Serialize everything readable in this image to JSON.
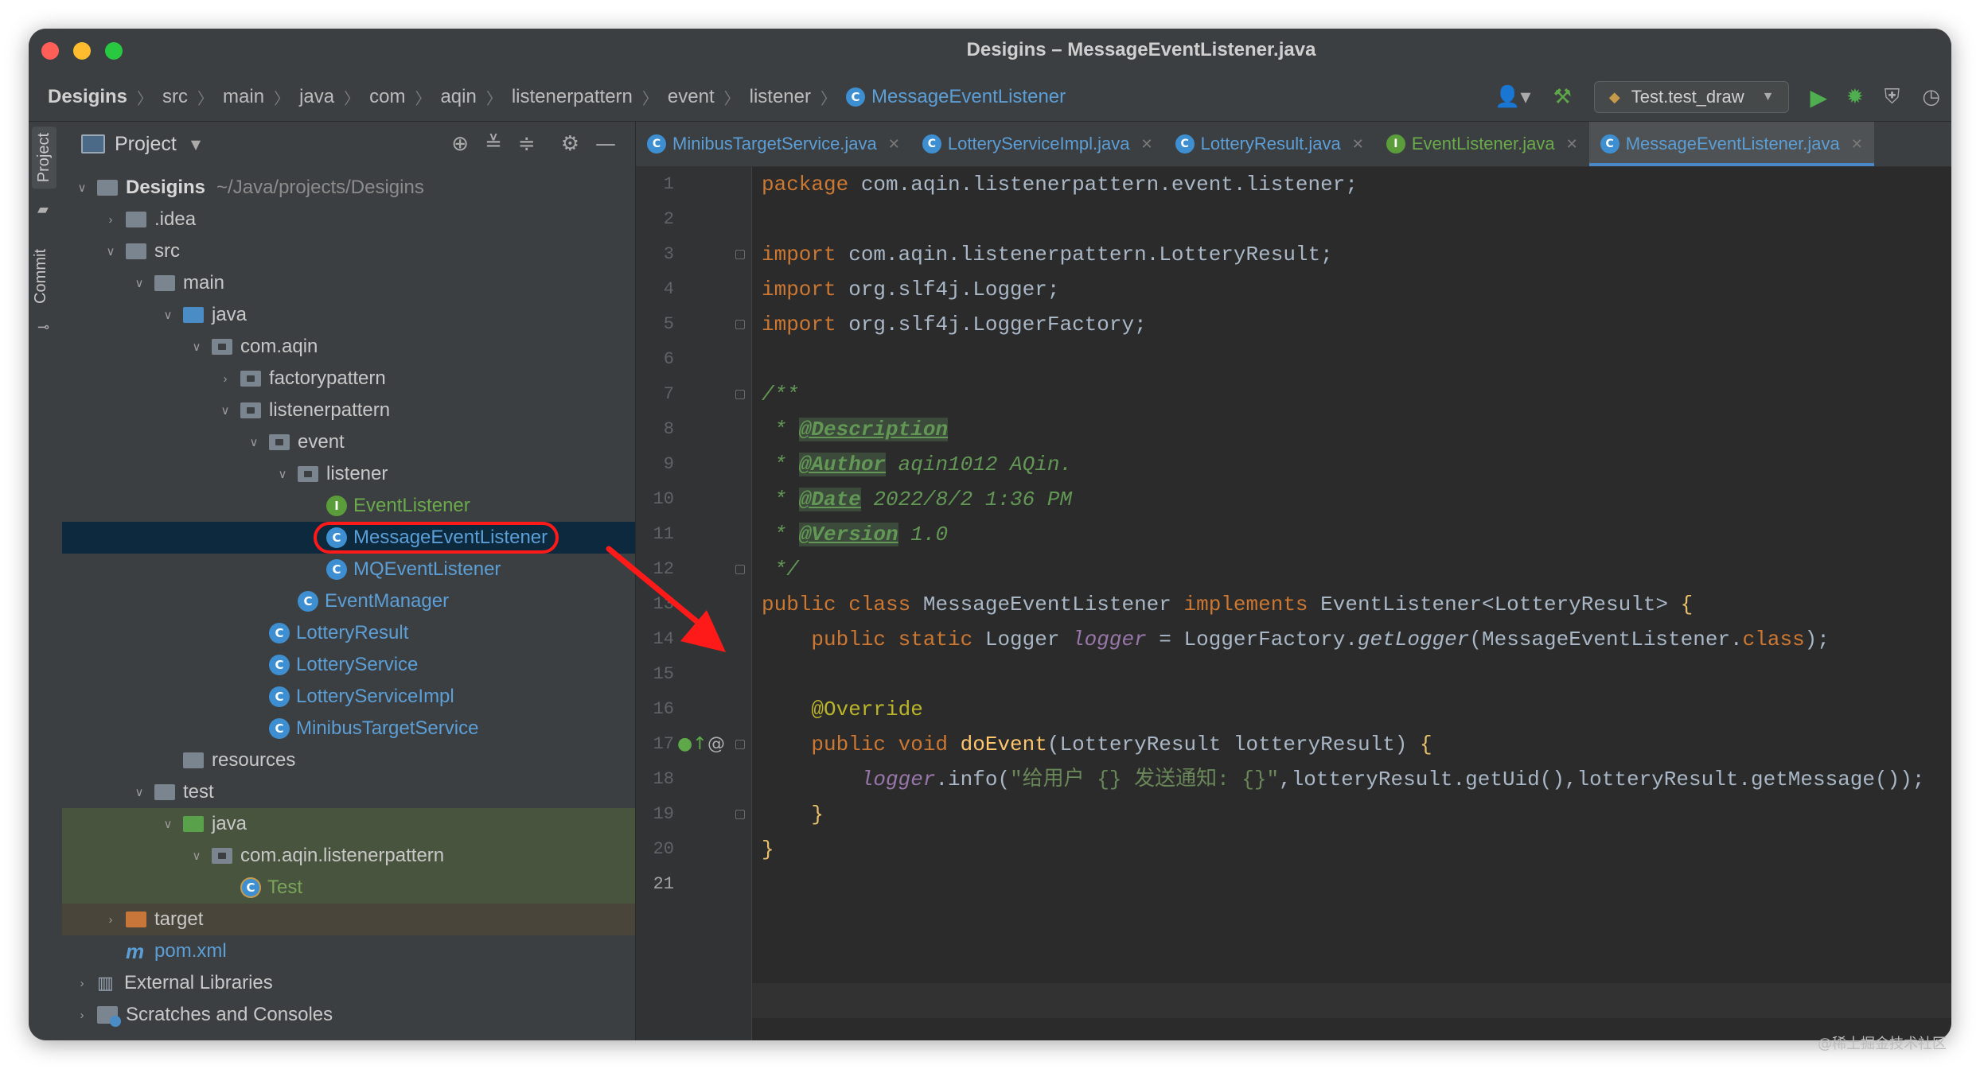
{
  "window": {
    "title": "Desigins – MessageEventListener.java"
  },
  "breadcrumbs": [
    "Desigins",
    "src",
    "main",
    "java",
    "com",
    "aqin",
    "listenerpattern",
    "event",
    "listener",
    "MessageEventListener"
  ],
  "toolbar": {
    "run_config": "Test.test_draw",
    "icons": [
      "user-icon",
      "hammer-icon",
      "run-icon",
      "debug-icon",
      "coverage-icon",
      "profiler-icon"
    ]
  },
  "side_stripe": {
    "project_label": "Project",
    "commit_label": "Commit"
  },
  "project_panel": {
    "title": "Project",
    "tree": [
      {
        "label": "Desigins",
        "path": "~/Java/projects/Desigins"
      },
      {
        "label": ".idea"
      },
      {
        "label": "src"
      },
      {
        "label": "main"
      },
      {
        "label": "java"
      },
      {
        "label": "com.aqin"
      },
      {
        "label": "factorypattern"
      },
      {
        "label": "listenerpattern"
      },
      {
        "label": "event"
      },
      {
        "label": "listener"
      },
      {
        "label": "EventListener"
      },
      {
        "label": "MessageEventListener"
      },
      {
        "label": "MQEventListener"
      },
      {
        "label": "EventManager"
      },
      {
        "label": "LotteryResult"
      },
      {
        "label": "LotteryService"
      },
      {
        "label": "LotteryServiceImpl"
      },
      {
        "label": "MinibusTargetService"
      },
      {
        "label": "resources"
      },
      {
        "label": "test"
      },
      {
        "label": "java"
      },
      {
        "label": "com.aqin.listenerpattern"
      },
      {
        "label": "Test"
      },
      {
        "label": "target"
      },
      {
        "label": "pom.xml"
      },
      {
        "label": "External Libraries"
      },
      {
        "label": "Scratches and Consoles"
      }
    ],
    "selected": "MessageEventListener"
  },
  "editor": {
    "tabs": [
      {
        "label": "MinibusTargetService.java",
        "kind": "C"
      },
      {
        "label": "LotteryServiceImpl.java",
        "kind": "C"
      },
      {
        "label": "LotteryResult.java",
        "kind": "C"
      },
      {
        "label": "EventListener.java",
        "kind": "I"
      },
      {
        "label": "MessageEventListener.java",
        "kind": "C",
        "active": true
      }
    ],
    "line_numbers": [
      "1",
      "2",
      "3",
      "4",
      "5",
      "6",
      "7",
      "8",
      "9",
      "10",
      "11",
      "12",
      "13",
      "14",
      "15",
      "16",
      "17",
      "18",
      "19",
      "20",
      "21"
    ],
    "code": {
      "l1_kw": "package",
      "l1_rest": " com.aqin.listenerpattern.event.listener;",
      "l3_kw": "import",
      "l3_rest": " com.aqin.listenerpattern.LotteryResult;",
      "l4_kw": "import",
      "l4_rest": " org.slf4j.Logger;",
      "l5_kw": "import",
      "l5_rest": " org.slf4j.LoggerFactory;",
      "l7": "/**",
      "l8_star": " * ",
      "l8_tag": "@Description",
      "l9_star": " * ",
      "l9_tag": "@Author",
      "l9_val": " aqin1012 AQin.",
      "l10_star": " * ",
      "l10_tag": "@Date",
      "l10_val": " 2022/8/2 1:36 PM",
      "l11_star": " * ",
      "l11_tag": "@Version",
      "l11_val": " 1.0",
      "l12": " */",
      "l13_kw": "public class",
      "l13_name": " MessageEventListener ",
      "l13_impl": "implements",
      "l13_rest": " EventListener<LotteryResult> ",
      "l13_brace": "{",
      "l14_kw": "    public static",
      "l14_type": " Logger ",
      "l14_field": "logger",
      "l14_eq": " = LoggerFactory.",
      "l14_method": "getLogger",
      "l14_arg": "(MessageEventListener.",
      "l14_cls": "class",
      "l14_end": ");",
      "l16": "    @Override",
      "l17_kw": "    public void",
      "l17_method": " doEvent",
      "l17_rest": "(LotteryResult lotteryResult) ",
      "l17_brace": "{",
      "l18_field": "        logger",
      "l18_call": ".info(",
      "l18_str": "\"给用户 {} 发送通知: {}\"",
      "l18_rest": ",lotteryResult.getUid(),lotteryResult.getMessage());",
      "l19": "    }",
      "l20": "}"
    }
  },
  "watermark": "@稀土掘金技术社区",
  "colors": {
    "accent": "#4a88c7",
    "highlight_ring": "#ff1a1a",
    "arrow": "#ff1a1a"
  }
}
